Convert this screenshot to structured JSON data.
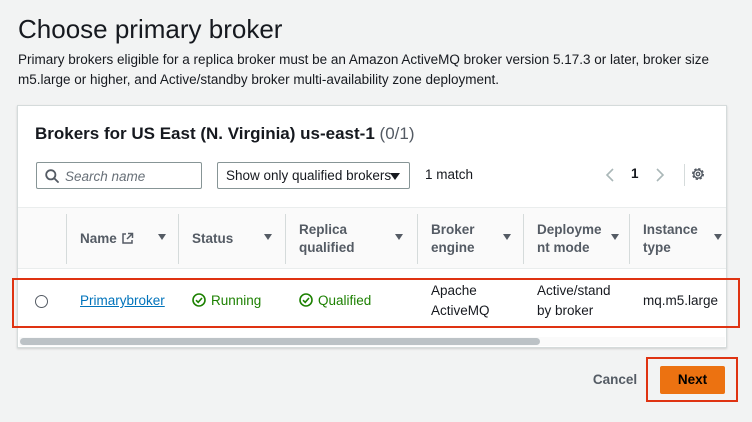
{
  "page": {
    "title": "Choose primary broker",
    "description": "Primary brokers eligible for a replica broker must be an Amazon ActiveMQ broker version 5.17.3 or later, broker size m5.large or higher, and Active/standby broker multi-availability zone deployment."
  },
  "panel": {
    "title": "Brokers for US East (N. Virginia) us-east-1",
    "count": "(0/1)",
    "search_placeholder": "Search name",
    "filter_selected": "Show only qualified brokers",
    "match_text": "1 match",
    "page_number": "1"
  },
  "table": {
    "columns": {
      "name": "Name",
      "status": "Status",
      "replica": "Replica qualified",
      "engine": "Broker engine",
      "deployment": "Deployme nt mode",
      "instance": "Instance type"
    },
    "rows": [
      {
        "name": "Primarybroker",
        "status": "Running",
        "replica": "Qualified",
        "engine": "Apache ActiveMQ",
        "deployment": "Active/stand by broker",
        "instance": "mq.m5.large"
      }
    ]
  },
  "footer": {
    "cancel_label": "Cancel",
    "next_label": "Next"
  },
  "colors": {
    "primary_button": "#ec7211",
    "link": "#0073bb",
    "success": "#1d8102",
    "highlight": "#df3312"
  },
  "icons": {
    "search": "search-icon",
    "external": "external-link-icon",
    "status": "check-circle-icon",
    "settings": "gear-icon"
  }
}
